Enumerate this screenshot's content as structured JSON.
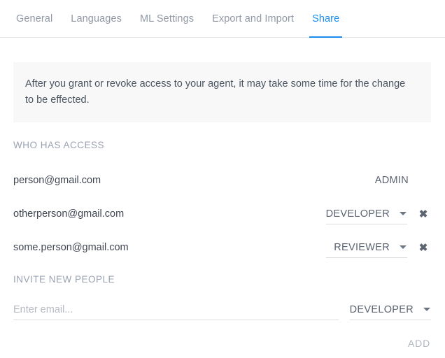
{
  "tabs": [
    {
      "label": "General",
      "active": false
    },
    {
      "label": "Languages",
      "active": false
    },
    {
      "label": "ML Settings",
      "active": false
    },
    {
      "label": "Export and Import",
      "active": false
    },
    {
      "label": "Share",
      "active": true
    }
  ],
  "banner": {
    "text": "After you grant or revoke access to your agent, it may take some time for the change to be effected."
  },
  "who_has_access": {
    "title": "WHO HAS ACCESS",
    "rows": [
      {
        "email": "person@gmail.com",
        "role": "ADMIN",
        "editable": false,
        "removable": false
      },
      {
        "email": "otherperson@gmail.com",
        "role": "DEVELOPER",
        "editable": true,
        "removable": true,
        "remove_icon": "close-icon"
      },
      {
        "email": "some.person@gmail.com",
        "role": "REVIEWER",
        "editable": true,
        "removable": true,
        "remove_icon": "close-icon"
      }
    ]
  },
  "invite_new_people": {
    "title": "INVITE NEW PEOPLE",
    "email_placeholder": "Enter email...",
    "email_value": "",
    "role": "DEVELOPER",
    "add_label": "ADD"
  },
  "icons": {
    "caret": "chevron-down-icon",
    "close": "close-icon"
  },
  "colors": {
    "accent": "#1a8cf0",
    "tab_inactive": "#9099a6",
    "section_title": "#9aa2b2",
    "body_text": "#3f4652",
    "banner_bg": "#f8f8f9",
    "disabled": "#b0b6bf",
    "divider": "#dcdcdc"
  }
}
